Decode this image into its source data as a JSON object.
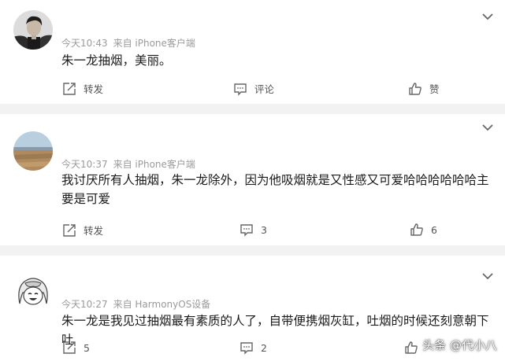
{
  "colors": {
    "meta_text": "#9a9a9a",
    "body_text": "#1a1a1a",
    "action_text": "#555555",
    "divider": "#f2f2f2"
  },
  "posts": [
    {
      "time": "今天10:43",
      "source": "来自 iPhone客户端",
      "text": "朱一龙抽烟，美丽。",
      "repost_label": "转发",
      "comment_label": "评论",
      "like_label": "赞",
      "avatar_icon": "user-photo-avatar"
    },
    {
      "time": "今天10:37",
      "source": "来自 iPhone客户端",
      "text": "我讨厌所有人抽烟，朱一龙除外，因为他吸烟就是又性感又可爱哈哈哈哈哈哈主要是可爱",
      "repost_label": "转发",
      "comment_label": "3",
      "like_label": "6",
      "avatar_icon": "landscape-avatar"
    },
    {
      "time": "今天10:27",
      "source": "来自 HarmonyOS设备",
      "text": "朱一龙是我见过抽烟最有素质的人了，自带便携烟灰缸，吐烟的时候还刻意朝下吐",
      "repost_label": "5",
      "comment_label": "2",
      "like_label": "",
      "avatar_icon": "cartoon-girl-avatar"
    }
  ],
  "watermark": "头条 @代小八"
}
